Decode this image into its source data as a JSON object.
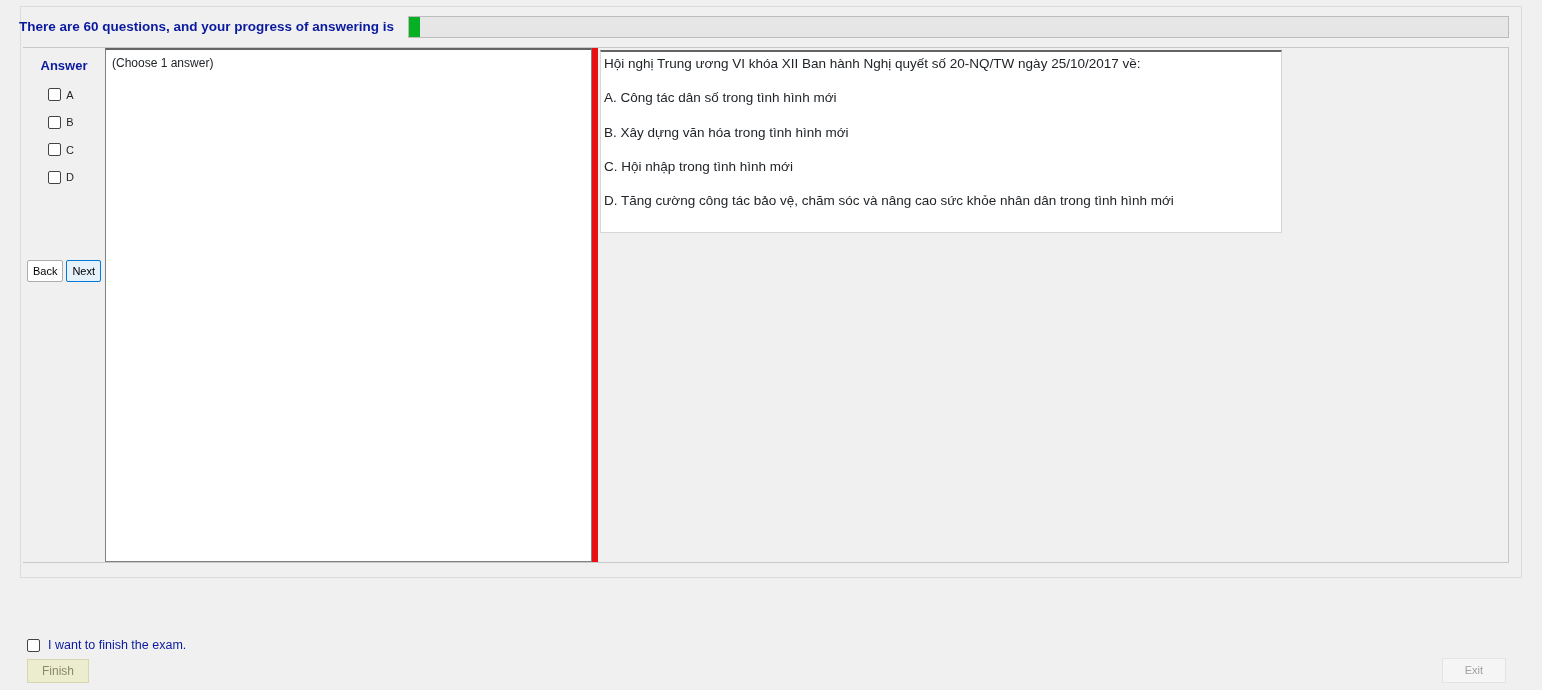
{
  "header": {
    "text": "There are 60 questions, and your progress of answering is",
    "progress": {
      "level": 0.01
    }
  },
  "answer_panel": {
    "title": "Answer",
    "options": [
      {
        "label": "A",
        "checked": false
      },
      {
        "label": "B",
        "checked": false
      },
      {
        "label": "C",
        "checked": false
      },
      {
        "label": "D",
        "checked": false
      }
    ],
    "buttons": [
      {
        "label": "Back",
        "selected": false
      },
      {
        "label": "Next",
        "selected": true
      }
    ]
  },
  "instruction": "(Choose 1 answer)",
  "question": {
    "text": "Hội nghị Trung ương VI khóa XII Ban hành Nghị quyết số 20-NQ/TW ngày 25/10/2017 về:",
    "choices": [
      "A.  Công tác dân số trong tình hình mới",
      "B.  Xây dựng văn hóa trong tình hình mới",
      "C.  Hội nhập trong tình hình mới",
      "D.  Tăng cường công tác bảo vệ, chăm sóc và nâng cao sức khỏe nhân dân trong tình hình mới"
    ]
  },
  "finish": {
    "label": "I want to finish the exam.",
    "checked": false,
    "button": {
      "label": "Finish",
      "disabled": true
    }
  },
  "exit_button": {
    "label": "Exit",
    "disabled": true
  }
}
